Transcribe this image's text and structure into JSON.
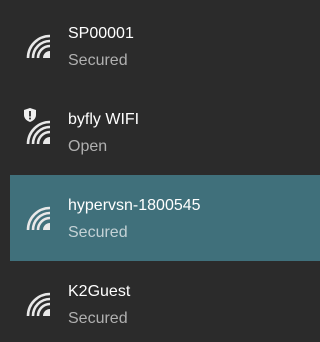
{
  "networks": [
    {
      "ssid": "SP00001",
      "status": "Secured",
      "icon": "wifi-icon",
      "selected": false
    },
    {
      "ssid": "byfly WIFI",
      "status": "Open",
      "icon": "wifi-icon",
      "badge_icon": "shield-alert-icon",
      "selected": false
    },
    {
      "ssid": "hypervsn-1800545",
      "status": "Secured",
      "icon": "wifi-icon",
      "selected": true
    },
    {
      "ssid": "K2Guest",
      "status": "Secured",
      "icon": "wifi-icon",
      "selected": false
    }
  ],
  "colors": {
    "background": "#2b2b2b",
    "selected_background": "#40707b",
    "ssid_text": "#ffffff",
    "status_text": "#b0b0b0",
    "icon": "#e8e8e8"
  }
}
